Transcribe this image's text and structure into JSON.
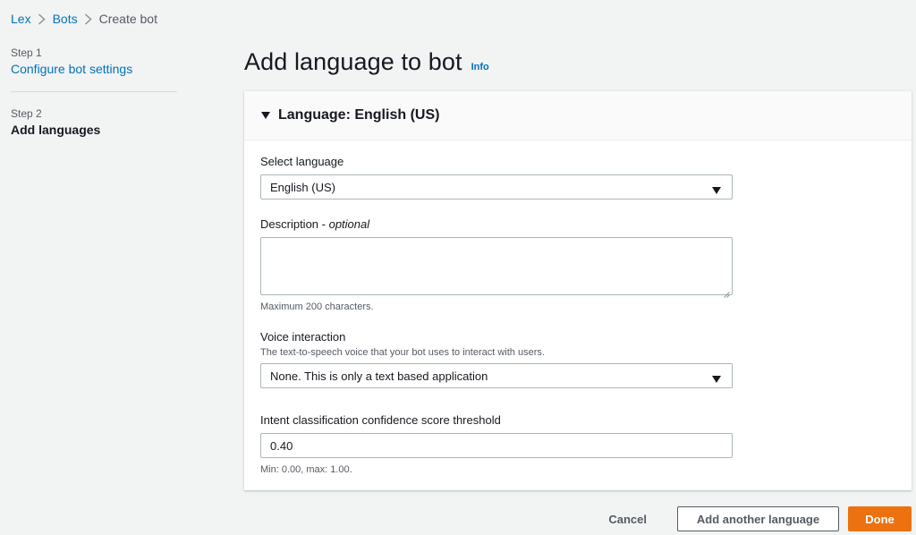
{
  "breadcrumb": {
    "items": [
      "Lex",
      "Bots",
      "Create bot"
    ]
  },
  "steps": [
    {
      "label": "Step 1",
      "title": "Configure bot settings"
    },
    {
      "label": "Step 2",
      "title": "Add languages"
    }
  ],
  "page": {
    "title": "Add language to bot",
    "info": "Info"
  },
  "panel": {
    "title": "Language: English (US)"
  },
  "fields": {
    "language": {
      "label": "Select language",
      "value": "English (US)"
    },
    "description": {
      "label": "Description",
      "optional": "optional",
      "value": "",
      "hint": "Maximum 200 characters."
    },
    "voice": {
      "label": "Voice interaction",
      "description": "The text-to-speech voice that your bot uses to interact with users.",
      "value": "None. This is only a text based application"
    },
    "threshold": {
      "label": "Intent classification confidence score threshold",
      "value": "0.40",
      "hint": "Min: 0.00, max: 1.00."
    }
  },
  "footer": {
    "cancel": "Cancel",
    "add_another": "Add another language",
    "done": "Done"
  },
  "colors": {
    "link": "#0073bb",
    "primary": "#ec7211",
    "background": "#f2f3f3"
  }
}
